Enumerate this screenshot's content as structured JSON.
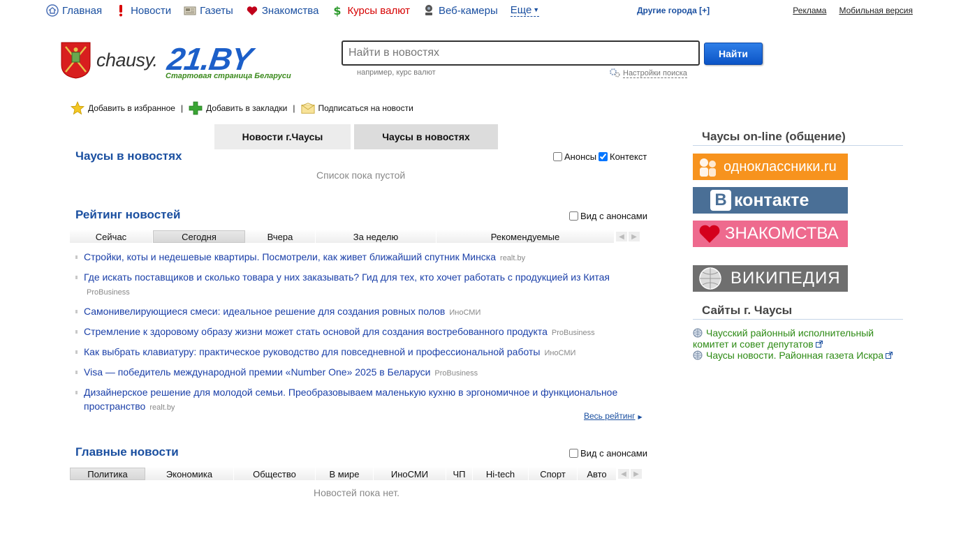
{
  "topnav": {
    "items": [
      {
        "label": "Главная",
        "icon": "home-icon"
      },
      {
        "label": "Новости",
        "icon": "exclamation-icon"
      },
      {
        "label": "Газеты",
        "icon": "newspaper-icon"
      },
      {
        "label": "Знакомства",
        "icon": "heart-icon"
      },
      {
        "label": "Курсы валют",
        "icon": "dollar-icon"
      },
      {
        "label": "Веб-камеры",
        "icon": "webcam-icon"
      }
    ],
    "more_label": "Еще",
    "other_cities": "Другие города [+]",
    "ads": "Реклама",
    "mobile": "Мобильная версия"
  },
  "logo": {
    "city": "chausy.",
    "brand": "21.BY",
    "tagline": "Стартовая страница Беларуси"
  },
  "search": {
    "placeholder": "Найти в новостях",
    "button": "Найти",
    "hint": "например, курс валют",
    "settings": "Настройки поиска"
  },
  "actions": {
    "favorites": "Добавить в избранное",
    "bookmarks": "Добавить в закладки",
    "subscribe": "Подписаться на новости"
  },
  "tabs": {
    "city_news": "Новости г.Чаусы",
    "in_news": "Чаусы в новостях"
  },
  "in_news": {
    "title": "Чаусы в новостях",
    "announces": "Анонсы",
    "context": "Контекст",
    "empty": "Список пока пустой"
  },
  "rating": {
    "title": "Рейтинг новостей",
    "view_announces": "Вид с анонсами",
    "tabs": [
      "Сейчас",
      "Сегодня",
      "Вчера",
      "За неделю",
      "Рекомендуемые"
    ],
    "active_tab": "Сегодня",
    "items": [
      {
        "text": "Стройки, коты и недешевые квартиры. Посмотрели, как живет ближайший спутник Минска",
        "source": "realt.by"
      },
      {
        "text": "Где искать поставщиков и сколько товара у них заказывать? Гид для тех, кто хочет работать с продукцией из Китая",
        "source": "ProBusiness"
      },
      {
        "text": "Самонивелирующиеся смеси: идеальное решение для создания ровных полов",
        "source": "ИноСМИ"
      },
      {
        "text": "Стремление к здоровому образу жизни может стать основой для создания востребованного продукта",
        "source": "ProBusiness"
      },
      {
        "text": "Как выбрать клавиатуру: практическое руководство для повседневной и профессиональной работы",
        "source": "ИноСМИ"
      },
      {
        "text": "Visa — победитель международной премии «Number One» 2025 в Беларуси",
        "source": "ProBusiness"
      },
      {
        "text": "Дизайнерское решение для молодой семьи. Преобразовываем маленькую кухню в эргономичное и функциональное пространство",
        "source": "realt.by"
      }
    ],
    "all_link": "Весь рейтинг"
  },
  "main_news": {
    "title": "Главные новости",
    "view_announces": "Вид с анонсами",
    "tabs": [
      "Политика",
      "Экономика",
      "Общество",
      "В мире",
      "ИноСМИ",
      "ЧП",
      "Hi-tech",
      "Спорт",
      "Авто"
    ],
    "active_tab": "Политика",
    "empty": "Новостей пока нет."
  },
  "sidebar": {
    "online_title": "Чаусы on-line (общение)",
    "banners": {
      "ok": "одноклассники.ru",
      "vk": "контакте",
      "vk_logo_letter": "В",
      "dating": "ЗНАКОМСТВА",
      "wiki": "ВИКИПЕДИЯ"
    },
    "sites_title": "Сайты г. Чаусы",
    "sites": [
      "Чаусский районный исполнительный комитет и совет депутатов",
      "Чаусы новости. Районная газета Искра"
    ]
  },
  "colors": {
    "link_blue": "#1a4fa0",
    "site_green": "#2d8a14",
    "brand_blue": "#1c5fc9",
    "ok_orange": "#f7931e",
    "vk_blue": "#4a6f96",
    "dating_pink": "#ee6a8e",
    "wiki_gray": "#6f6f6f"
  }
}
